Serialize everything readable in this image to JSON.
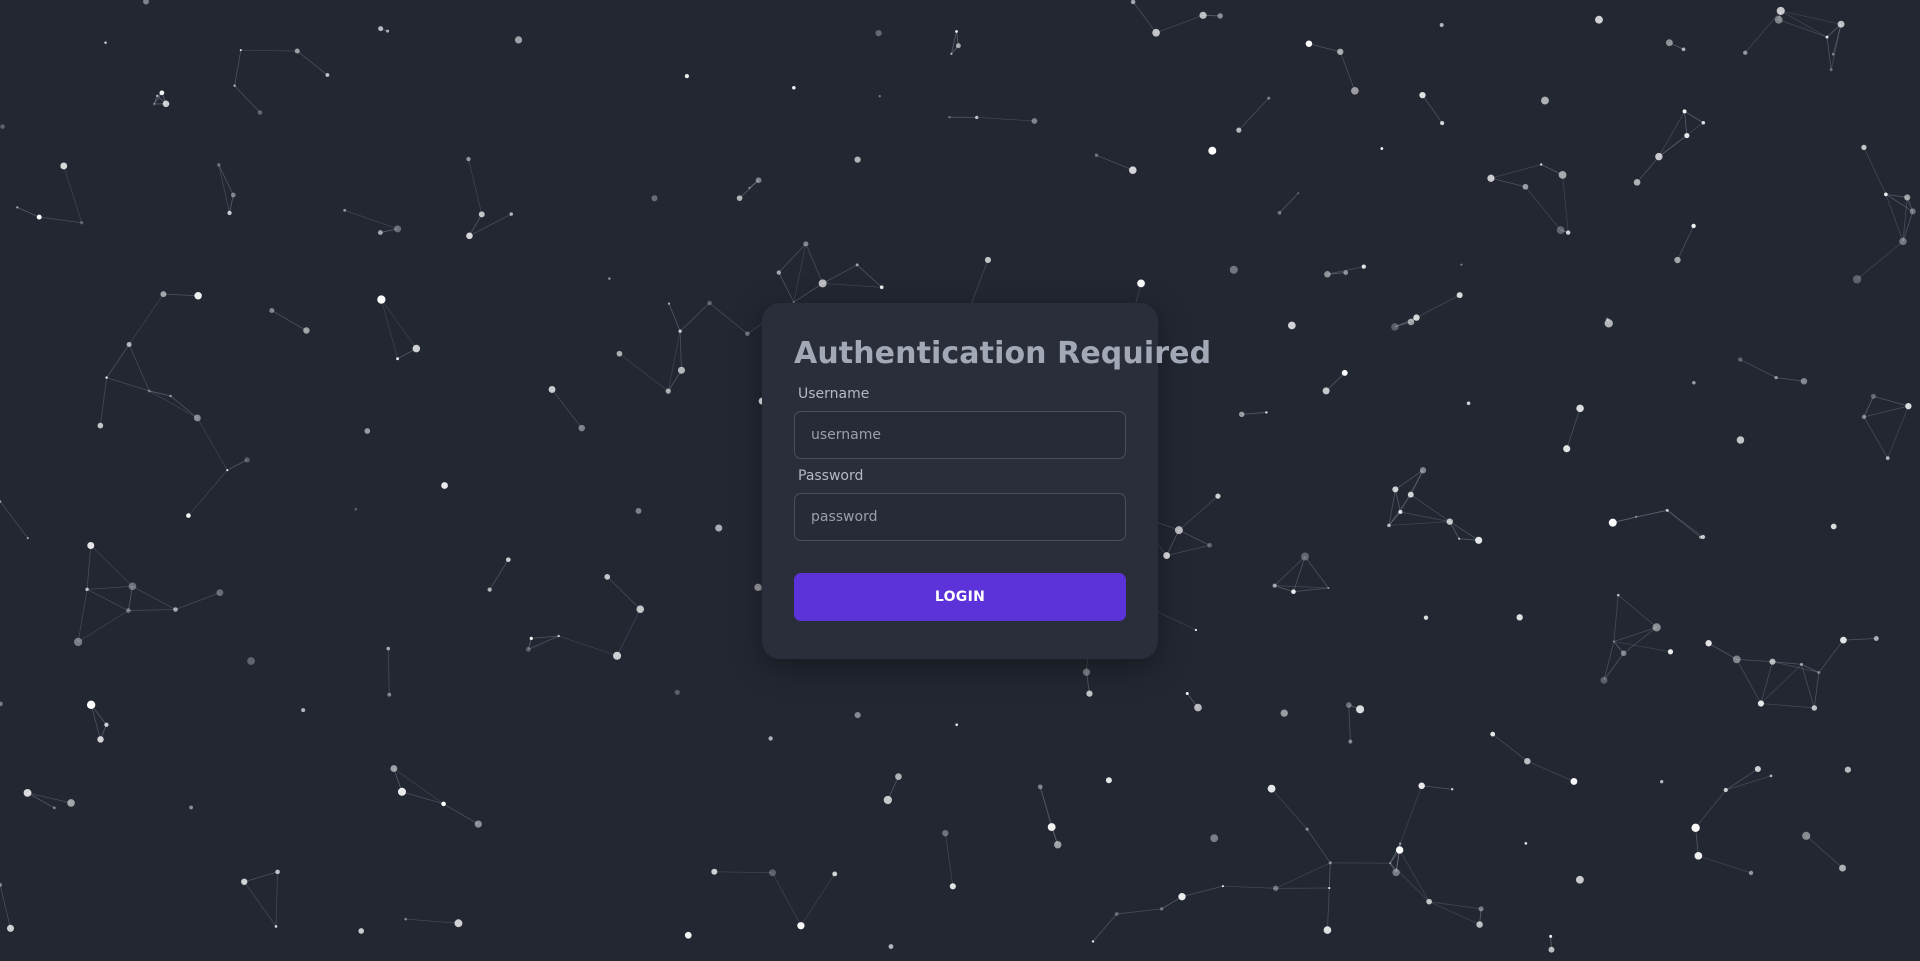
{
  "background": {
    "color": "#222732",
    "decoration": "star-constellation-network"
  },
  "auth": {
    "title": "Authentication Required",
    "username_label": "Username",
    "username_placeholder": "username",
    "username_value": "",
    "password_label": "Password",
    "password_placeholder": "password",
    "password_value": "",
    "login_label": "LOGIN"
  },
  "colors": {
    "card": "#2a2e3b",
    "accent": "#5c33d9",
    "title": "#a3a8b7"
  }
}
